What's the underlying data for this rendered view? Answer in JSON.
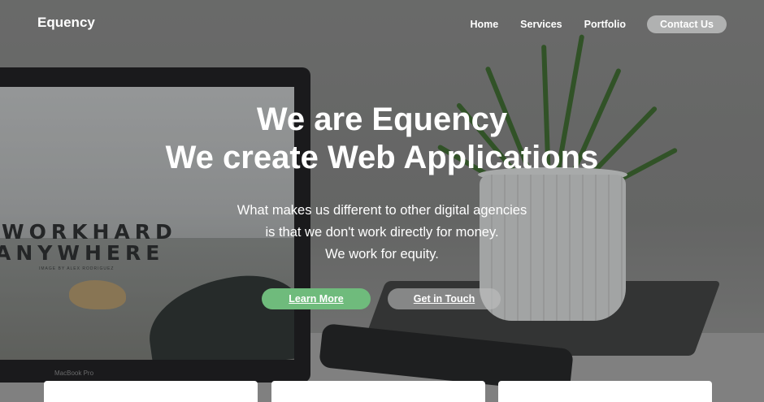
{
  "header": {
    "brand": "Equency",
    "nav": [
      {
        "label": "Home"
      },
      {
        "label": "Services"
      },
      {
        "label": "Portfolio"
      }
    ],
    "cta_label": "Contact Us"
  },
  "hero": {
    "title_line1": "We are Equency",
    "title_line2": "We create Web Applications",
    "subtitle_lines": [
      "What makes us different to other digital agencies",
      "is that we don't work directly for money.",
      "We work for equity."
    ],
    "primary_button": "Learn More",
    "secondary_button": "Get in Touch"
  },
  "background": {
    "laptop_text_line1": "WORKHARD",
    "laptop_text_line2": "ANYWHERE",
    "laptop_caption": "IMAGE BY ALEX RODRIGUEZ",
    "laptop_brand": "MacBook Pro"
  },
  "colors": {
    "primary_button": "#6fbb7c",
    "text": "#ffffff",
    "card": "#ffffff"
  }
}
